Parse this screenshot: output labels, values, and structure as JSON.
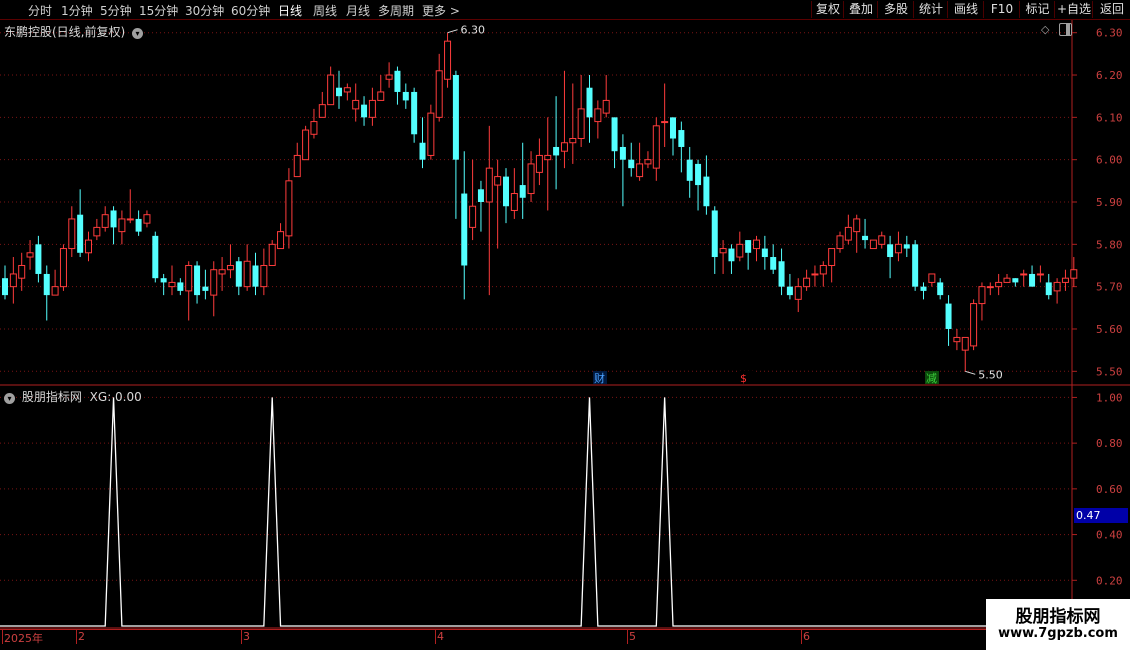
{
  "toolbar": {
    "period_tabs": [
      "分时",
      "1分钟",
      "5分钟",
      "15分钟",
      "30分钟",
      "60分钟",
      "日线",
      "周线",
      "月线",
      "多周期",
      "更多 >"
    ],
    "active_tab": "日线",
    "right_buttons": [
      "复权",
      "叠加",
      "多股",
      "统计",
      "画线",
      "F10",
      "标记",
      "+自选",
      "返回"
    ]
  },
  "main_panel": {
    "title": "东鹏控股(日线,前复权)",
    "high_marker": "6.30",
    "low_marker": "5.50",
    "y_ticks": [
      "6.30",
      "6.20",
      "6.10",
      "6.00",
      "5.90",
      "5.80",
      "5.70",
      "5.60",
      "5.50"
    ],
    "events": [
      {
        "label": "财",
        "color": "#4aa0ff"
      },
      {
        "label": "$",
        "color": "#ff3030"
      },
      {
        "label": "减",
        "color": "#3cd03c"
      }
    ]
  },
  "indicator_panel": {
    "title": "股朋指标网",
    "series_label": "XG: 0.00",
    "y_ticks": [
      "1.00",
      "0.80",
      "0.60",
      "0.40",
      "0.20"
    ],
    "current_value": "0.47"
  },
  "x_axis": {
    "labels": [
      "2025年",
      "2",
      "3",
      "4",
      "5",
      "6"
    ]
  },
  "watermark": {
    "line1": "股朋指标网",
    "line2": "www.7gpzb.com"
  },
  "chart_data": [
    {
      "type": "candlestick",
      "title": "东鹏控股(日线,前复权)",
      "ylim": [
        5.47,
        6.33
      ],
      "candles": [
        [
          5.72,
          5.68,
          5.75,
          5.67
        ],
        [
          5.7,
          5.73,
          5.77,
          5.66
        ],
        [
          5.72,
          5.75,
          5.78,
          5.69
        ],
        [
          5.77,
          5.78,
          5.81,
          5.74
        ],
        [
          5.8,
          5.73,
          5.82,
          5.71
        ],
        [
          5.73,
          5.68,
          5.75,
          5.62
        ],
        [
          5.68,
          5.7,
          5.74,
          5.68
        ],
        [
          5.7,
          5.79,
          5.8,
          5.69
        ],
        [
          5.79,
          5.86,
          5.89,
          5.77
        ],
        [
          5.87,
          5.78,
          5.93,
          5.77
        ],
        [
          5.78,
          5.81,
          5.83,
          5.76
        ],
        [
          5.82,
          5.84,
          5.86,
          5.81
        ],
        [
          5.84,
          5.87,
          5.89,
          5.83
        ],
        [
          5.88,
          5.84,
          5.89,
          5.8
        ],
        [
          5.83,
          5.86,
          5.88,
          5.8
        ],
        [
          5.86,
          5.86,
          5.93,
          5.85
        ],
        [
          5.86,
          5.83,
          5.88,
          5.82
        ],
        [
          5.85,
          5.87,
          5.88,
          5.84
        ],
        [
          5.82,
          5.72,
          5.83,
          5.71
        ],
        [
          5.72,
          5.71,
          5.73,
          5.68
        ],
        [
          5.7,
          5.71,
          5.75,
          5.68
        ],
        [
          5.71,
          5.69,
          5.72,
          5.68
        ],
        [
          5.69,
          5.75,
          5.76,
          5.62
        ],
        [
          5.75,
          5.68,
          5.76,
          5.66
        ],
        [
          5.7,
          5.69,
          5.74,
          5.67
        ],
        [
          5.68,
          5.74,
          5.76,
          5.63
        ],
        [
          5.73,
          5.74,
          5.77,
          5.69
        ],
        [
          5.74,
          5.75,
          5.8,
          5.72
        ],
        [
          5.76,
          5.7,
          5.77,
          5.68
        ],
        [
          5.7,
          5.76,
          5.8,
          5.69
        ],
        [
          5.75,
          5.7,
          5.78,
          5.68
        ],
        [
          5.7,
          5.75,
          5.79,
          5.68
        ],
        [
          5.75,
          5.8,
          5.81,
          5.75
        ],
        [
          5.79,
          5.83,
          5.85,
          5.79
        ],
        [
          5.82,
          5.95,
          5.98,
          5.79
        ],
        [
          5.96,
          6.01,
          6.04,
          5.96
        ],
        [
          6.0,
          6.07,
          6.08,
          6.0
        ],
        [
          6.06,
          6.09,
          6.12,
          6.05
        ],
        [
          6.1,
          6.13,
          6.16,
          6.1
        ],
        [
          6.13,
          6.2,
          6.22,
          6.13
        ],
        [
          6.17,
          6.15,
          6.21,
          6.12
        ],
        [
          6.16,
          6.17,
          6.18,
          6.14
        ],
        [
          6.12,
          6.14,
          6.18,
          6.09
        ],
        [
          6.13,
          6.1,
          6.15,
          6.08
        ],
        [
          6.1,
          6.14,
          6.17,
          6.08
        ],
        [
          6.14,
          6.16,
          6.2,
          6.14
        ],
        [
          6.19,
          6.2,
          6.23,
          6.17
        ],
        [
          6.21,
          6.16,
          6.22,
          6.13
        ],
        [
          6.16,
          6.14,
          6.18,
          6.12
        ],
        [
          6.16,
          6.06,
          6.17,
          6.04
        ],
        [
          6.04,
          6.0,
          6.1,
          5.98
        ],
        [
          6.01,
          6.11,
          6.13,
          6.0
        ],
        [
          6.1,
          6.21,
          6.25,
          6.09
        ],
        [
          6.19,
          6.28,
          6.3,
          6.17
        ],
        [
          6.2,
          6.0,
          6.21,
          5.86
        ],
        [
          5.92,
          5.75,
          6.02,
          5.67
        ],
        [
          5.84,
          5.89,
          6.0,
          5.81
        ],
        [
          5.93,
          5.9,
          5.95,
          5.83
        ],
        [
          5.9,
          5.98,
          6.08,
          5.68
        ],
        [
          5.94,
          5.96,
          6.0,
          5.79
        ],
        [
          5.96,
          5.89,
          5.98,
          5.85
        ],
        [
          5.88,
          5.92,
          5.98,
          5.86
        ],
        [
          5.94,
          5.91,
          6.04,
          5.86
        ],
        [
          5.92,
          5.99,
          6.02,
          5.9
        ],
        [
          5.97,
          6.01,
          6.05,
          5.94
        ],
        [
          6.0,
          6.01,
          6.1,
          5.88
        ],
        [
          6.03,
          6.01,
          6.15,
          5.93
        ],
        [
          6.02,
          6.04,
          6.21,
          5.98
        ],
        [
          6.04,
          6.05,
          6.18,
          5.99
        ],
        [
          6.05,
          6.12,
          6.2,
          6.03
        ],
        [
          6.17,
          6.1,
          6.2,
          6.04
        ],
        [
          6.09,
          6.12,
          6.14,
          6.05
        ],
        [
          6.11,
          6.14,
          6.2,
          6.1
        ],
        [
          6.1,
          6.02,
          6.1,
          5.98
        ],
        [
          6.03,
          6.0,
          6.06,
          5.89
        ],
        [
          6.0,
          5.98,
          6.04,
          5.96
        ],
        [
          5.96,
          5.99,
          6.04,
          5.95
        ],
        [
          5.99,
          6.0,
          6.02,
          5.98
        ],
        [
          5.98,
          6.08,
          6.1,
          5.95
        ],
        [
          6.09,
          6.09,
          6.18,
          6.03
        ],
        [
          6.1,
          6.05,
          6.1,
          6.01
        ],
        [
          6.07,
          6.03,
          6.09,
          5.97
        ],
        [
          6.0,
          5.95,
          6.03,
          5.91
        ],
        [
          5.99,
          5.94,
          6.0,
          5.88
        ],
        [
          5.96,
          5.89,
          6.01,
          5.87
        ],
        [
          5.88,
          5.77,
          5.89,
          5.73
        ],
        [
          5.78,
          5.79,
          5.81,
          5.73
        ],
        [
          5.79,
          5.76,
          5.8,
          5.73
        ],
        [
          5.77,
          5.8,
          5.83,
          5.76
        ],
        [
          5.81,
          5.78,
          5.81,
          5.74
        ],
        [
          5.79,
          5.81,
          5.82,
          5.76
        ],
        [
          5.79,
          5.77,
          5.82,
          5.74
        ],
        [
          5.77,
          5.74,
          5.8,
          5.73
        ],
        [
          5.76,
          5.7,
          5.79,
          5.68
        ],
        [
          5.7,
          5.68,
          5.73,
          5.67
        ],
        [
          5.67,
          5.7,
          5.72,
          5.64
        ],
        [
          5.7,
          5.72,
          5.74,
          5.69
        ],
        [
          5.73,
          5.73,
          5.75,
          5.7
        ],
        [
          5.73,
          5.75,
          5.76,
          5.7
        ],
        [
          5.75,
          5.79,
          5.79,
          5.71
        ],
        [
          5.79,
          5.82,
          5.83,
          5.78
        ],
        [
          5.81,
          5.84,
          5.87,
          5.8
        ],
        [
          5.83,
          5.86,
          5.87,
          5.78
        ],
        [
          5.82,
          5.81,
          5.86,
          5.79
        ],
        [
          5.79,
          5.81,
          5.81,
          5.79
        ],
        [
          5.8,
          5.82,
          5.83,
          5.79
        ],
        [
          5.8,
          5.77,
          5.82,
          5.72
        ],
        [
          5.78,
          5.8,
          5.83,
          5.76
        ],
        [
          5.8,
          5.79,
          5.82,
          5.77
        ],
        [
          5.8,
          5.7,
          5.81,
          5.69
        ],
        [
          5.7,
          5.69,
          5.71,
          5.67
        ],
        [
          5.71,
          5.73,
          5.73,
          5.7
        ],
        [
          5.71,
          5.68,
          5.72,
          5.67
        ],
        [
          5.66,
          5.6,
          5.68,
          5.56
        ],
        [
          5.57,
          5.58,
          5.6,
          5.55
        ],
        [
          5.55,
          5.58,
          5.58,
          5.5
        ],
        [
          5.56,
          5.66,
          5.67,
          5.55
        ],
        [
          5.66,
          5.7,
          5.71,
          5.62
        ],
        [
          5.7,
          5.7,
          5.71,
          5.68
        ],
        [
          5.7,
          5.71,
          5.73,
          5.68
        ],
        [
          5.71,
          5.72,
          5.73,
          5.71
        ],
        [
          5.72,
          5.71,
          5.72,
          5.7
        ],
        [
          5.73,
          5.73,
          5.74,
          5.7
        ],
        [
          5.73,
          5.7,
          5.75,
          5.7
        ],
        [
          5.73,
          5.73,
          5.75,
          5.71
        ],
        [
          5.71,
          5.68,
          5.73,
          5.67
        ],
        [
          5.69,
          5.71,
          5.72,
          5.66
        ],
        [
          5.71,
          5.72,
          5.74,
          5.69
        ],
        [
          5.72,
          5.74,
          5.77,
          5.7
        ]
      ]
    },
    {
      "type": "line",
      "title": "股朋指标网",
      "series": [
        {
          "name": "XG",
          "peaks_at_index": [
            13,
            32,
            70,
            79
          ],
          "peak_value": 1.0,
          "base_value": 0.0
        }
      ],
      "ylim": [
        0,
        1.05
      ]
    }
  ]
}
